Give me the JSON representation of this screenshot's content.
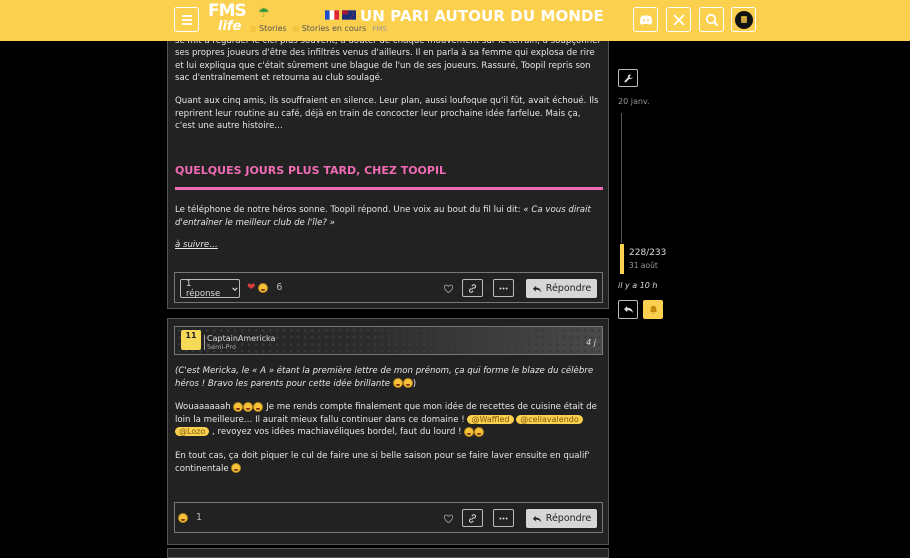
{
  "header": {
    "logo_line1": "FMS",
    "logo_line2": "life",
    "title": "UN PARI AUTOUR DU MONDE",
    "crumb1": "Stories",
    "crumb2": "Stories en cours",
    "crumb_tag": "FMS"
  },
  "post1": {
    "para1_partial": "aussi ... Mais au fur et à mesure que les lettres s'accumulaient, son esprit commença à vaciller. Il se mit à regarder le ciel plus souvent, à douter de chaque mouvement sur le terrain, à soupçonner ses propres joueurs d'être des infiltrés venus d'ailleurs. Il en parla à sa femme qui explosa de rire et lui expliqua que c'était sûrement une blague de l'un de ses joueurs. Rassuré, Toopil repris son sac d'entraînement et retourna au club soulagé.",
    "para2": "Quant aux cinq amis, ils souffraient en silence. Leur plan, aussi loufoque qu'il fût, avait échoué. Ils reprirent leur routine au café, déjà en train de concocter leur prochaine idée farfelue. Mais ça, c'est une autre histoire…",
    "heading": "QUELQUES JOURS PLUS TARD, CHEZ TOOPIL",
    "para3_plain": "Le téléphone de notre héros sonne. Toopil répond. Une voix au bout du fil lui dit: ",
    "para3_quote": "« Ca vous dirait d'entraîner le meilleur club de l'île? »",
    "to_be_continued": "à suivre…",
    "replies_label": "1 réponse",
    "reaction_count": "6",
    "reply_label": "Répondre"
  },
  "post2": {
    "username": "CaptainAmericka",
    "rank": "Semi-Pro",
    "badge": "11",
    "date": "4 j",
    "para1": "(C'est Mericka, le « A » étant la première lettre de mon prénom, ça qui forme le blaze du célèbre héros ! Bravo les parents pour cette idée brillante",
    "para2a": "Wouaaaaaah",
    "para2b": "Je me rends compte finalement que mon idée de recettes de cuisine était de loin la meilleure… Il aurait mieux fallu continuer dans ce domaine !",
    "mention1": "@Waffled",
    "mention2": "@celiavalendo",
    "mention3": "@Lozo",
    "para2c": ", revoyez vos idées machiavéliques bordel, faut du lourd !",
    "para3": "En tout cas, ça doit piquer le cul de faire une si belle saison pour se faire laver ensuite en qualif' continentale",
    "reaction_count": "1",
    "reply_label": "Répondre"
  },
  "timeline": {
    "start_date": "20 janv.",
    "position": "228/233",
    "position_date": "31 août",
    "ago": "il y a 10 h"
  },
  "colors": {
    "accent": "#fcd04f",
    "heading": "#f06bb3",
    "background": "#000000",
    "post_bg": "#222222"
  }
}
